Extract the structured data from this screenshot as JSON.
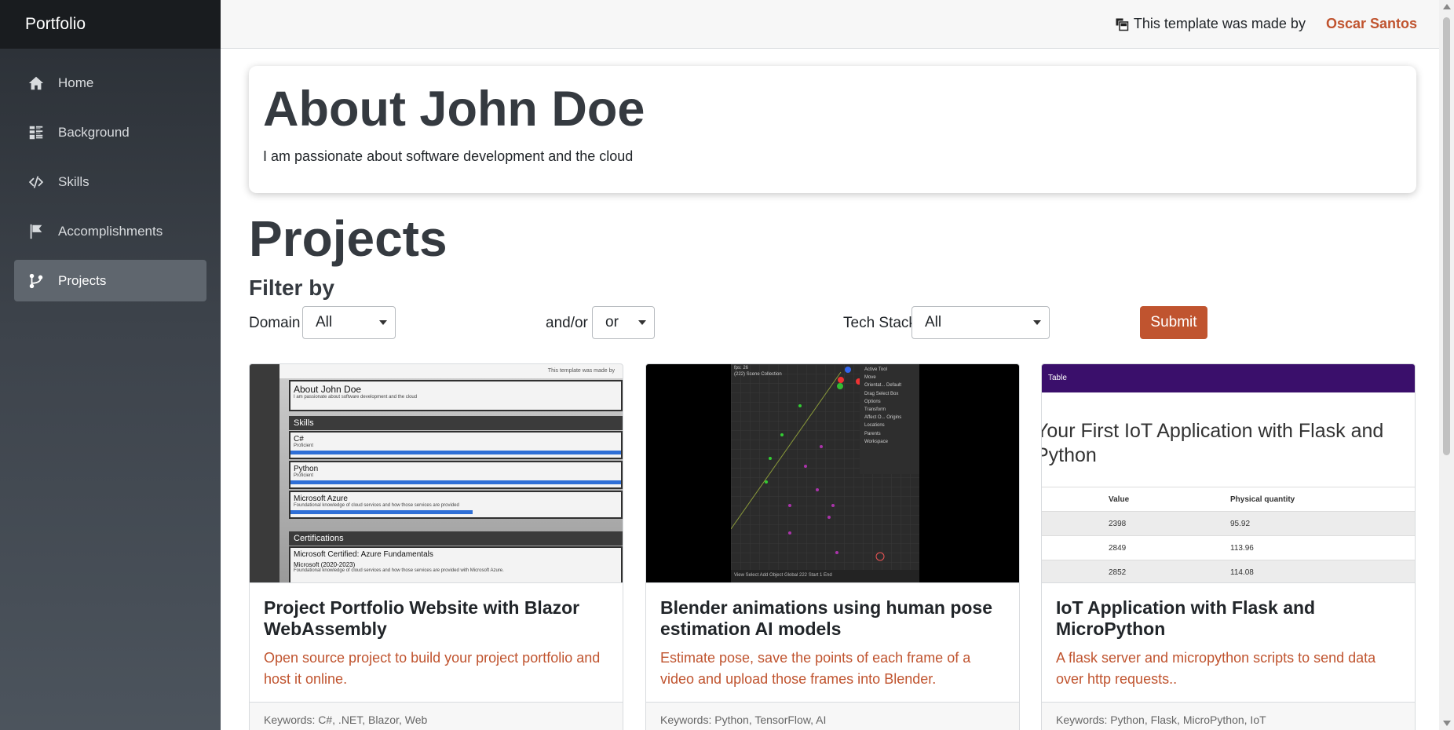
{
  "brand": "Portfolio",
  "sidebar": {
    "items": [
      {
        "label": "Home",
        "icon": "home-icon"
      },
      {
        "label": "Background",
        "icon": "list-icon"
      },
      {
        "label": "Skills",
        "icon": "code-icon"
      },
      {
        "label": "Accomplishments",
        "icon": "flag-icon"
      },
      {
        "label": "Projects",
        "icon": "git-branch-icon",
        "active": true
      }
    ]
  },
  "topbar": {
    "made_by": "This template was made by",
    "author": "Oscar Santos"
  },
  "about": {
    "title": "About John Doe",
    "subtitle": "I am passionate about software development and the cloud"
  },
  "projects": {
    "title": "Projects",
    "filter_title": "Filter by",
    "domain_label": "Domain",
    "domain_value": "All",
    "andor_label": "and/or",
    "andor_value": "or",
    "tech_label": "Tech Stack",
    "tech_value": "All",
    "submit_label": "Submit"
  },
  "cards": [
    {
      "title": "Project Portfolio Website with Blazor WebAssembly",
      "description": "Open source project to build your project portfolio and host it online.",
      "keywords": "Keywords: C#, .NET, Blazor, Web",
      "thumb": {
        "top": "This template was made by",
        "about": "About John Doe",
        "about_sub": "I am passionate about software development and the cloud",
        "skills": "Skills",
        "skill1": "C#",
        "skill1_level": "Proficient",
        "skill2": "Python",
        "skill2_level": "Proficient",
        "skill3": "Microsoft Azure",
        "skill3_level": "Foundational knowledge of cloud services and how those services are provided",
        "certs": "Certifications",
        "cert1": "Microsoft Certified: Azure Fundamentals",
        "cert1_date": "Microsoft (2020-2023)",
        "cert1_desc": "Foundational knowledge of cloud services and how those services are provided with Microsoft Azure."
      }
    },
    {
      "title": "Blender animations using human pose estimation AI models",
      "description": "Estimate pose, save the points of each frame of a video and upload those frames into Blender.",
      "keywords": "Keywords: Python, TensorFlow, AI",
      "thumb": {
        "fps": "fps: 26",
        "scene": "(222) Scene Collection",
        "panel": [
          "Active Tool",
          "Move",
          "Orientat...",
          "Default",
          "Drag",
          "Select Box",
          "Options",
          "Transform",
          "Affect O...",
          "Origins",
          "Locations",
          "Parents",
          "Workspace"
        ],
        "bottom": [
          "View",
          "Select",
          "Add",
          "Object",
          "Global",
          "222",
          "Start",
          "1",
          "End"
        ]
      }
    },
    {
      "title": "IoT Application with Flask and MicroPython",
      "description": "A flask server and micropython scripts to send data over http requests..",
      "keywords": "Keywords: Python, Flask, MicroPython, IoT",
      "thumb": {
        "header": "Table",
        "title_line1": "Your First IoT Application with Flask and",
        "title_line2": "Python",
        "columns": [
          "Value",
          "Physical quantity"
        ],
        "rows": [
          [
            "2398",
            "95.92"
          ],
          [
            "2849",
            "113.96"
          ],
          [
            "2852",
            "114.08"
          ]
        ]
      }
    }
  ]
}
